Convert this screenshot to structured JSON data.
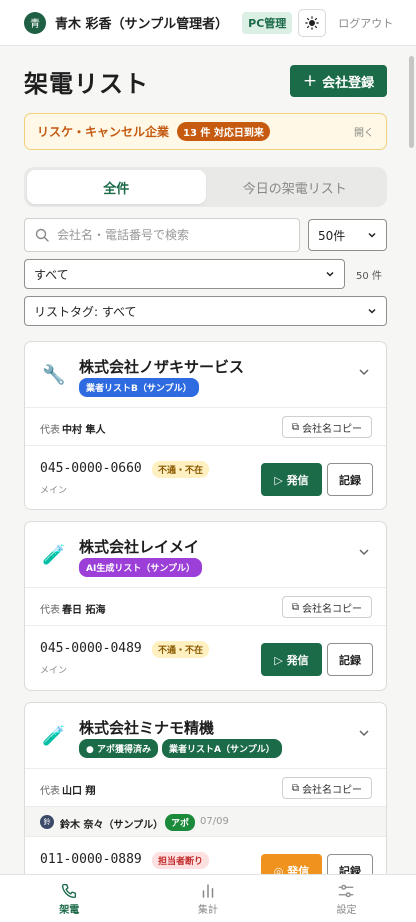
{
  "header": {
    "avatar_initial": "青",
    "user_name": "青木 彩香（サンプル管理者）",
    "mode_badge": "PC管理",
    "theme_icon": "sun-icon",
    "logout_label": "ログアウト"
  },
  "page": {
    "title": "架電リスト",
    "add_company_label": "会社登録"
  },
  "reschedule": {
    "label": "リスケ・キャンセル企業",
    "badge": "13 件 対応日到来",
    "toggle_label": "開く"
  },
  "tabs": [
    {
      "label": "全件",
      "active": true
    },
    {
      "label": "今日の架電リスト",
      "active": false
    }
  ],
  "filters": {
    "search_placeholder": "会社名・電話番号で検索",
    "per_page": "50件",
    "status_filter": "すべて",
    "result_count": "50 件",
    "tag_filter": "リストタグ: すべて"
  },
  "companies": [
    {
      "icon": "wrench-icon",
      "icon_glyph": "🔧",
      "name": "株式会社ノザキサービス",
      "tags": [
        {
          "label": "業者リストB（サンプル）",
          "color": "#2f6be0"
        }
      ],
      "rep_label": "代表",
      "rep_name": "中村 隼人",
      "copy_label": "会社名コピー",
      "phone": "045-0000-0660",
      "phone_type": "メイン",
      "status": "不通・不在",
      "call_label": "▷ 発信",
      "record_label": "記録"
    },
    {
      "icon": "test-tube-icon",
      "icon_glyph": "🧪",
      "name": "株式会社レイメイ",
      "tags": [
        {
          "label": "AI生成リスト（サンプル）",
          "color": "#9b3fd8"
        }
      ],
      "rep_label": "代表",
      "rep_name": "春日 拓海",
      "copy_label": "会社名コピー",
      "phone": "045-0000-0489",
      "phone_type": "メイン",
      "status": "不通・不在",
      "call_label": "▷ 発信",
      "record_label": "記録"
    },
    {
      "icon": "test-tube-icon",
      "icon_glyph": "🧪",
      "name": "株式会社ミナモ精機",
      "tags": [
        {
          "label": "● アポ獲得済み",
          "color": "#1b6a48"
        },
        {
          "label": "業者リストA（サンプル）",
          "color": "#1b6a48"
        }
      ],
      "rep_label": "代表",
      "rep_name": "山口 翔",
      "copy_label": "会社名コピー",
      "assignee": {
        "initial": "鈴",
        "name": "鈴木 奈々（サンプル）",
        "badge": "アポ",
        "date": "07/09"
      },
      "phone": "011-0000-0889",
      "status": "担当者断り",
      "call_label": "◎ 発信",
      "record_label": "記録"
    }
  ],
  "bottom_nav": [
    {
      "label": "架電",
      "icon": "phone-icon",
      "active": true
    },
    {
      "label": "集計",
      "icon": "bar-chart-icon",
      "active": false
    },
    {
      "label": "設定",
      "icon": "sliders-icon",
      "active": false
    }
  ],
  "colors": {
    "brand_green": "#1b6a48",
    "warning_orange": "#c55a10",
    "call_orange": "#f0931e"
  }
}
